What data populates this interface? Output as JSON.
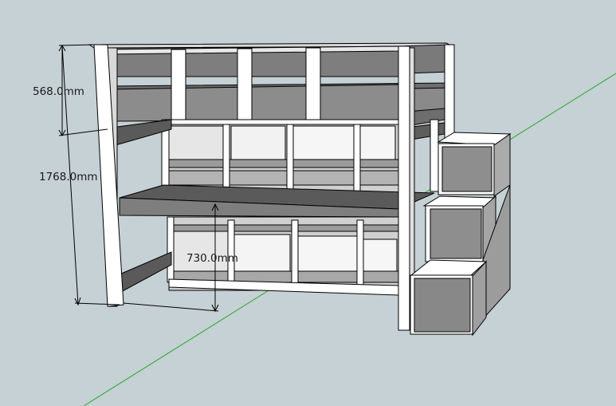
{
  "app": {
    "viewport_background": "#c5d1d5"
  },
  "scene": {
    "subject": "loft bed with desk, shelving and storage stairs",
    "axis_colors": {
      "green": "#2ea82e"
    },
    "material_colors": {
      "white_panel": "#ffffff",
      "light_gray_face": "#cfcfcf",
      "medium_gray_face": "#9a9a9a",
      "dark_gray_face": "#6e6e6e",
      "edge_line": "#000000"
    }
  },
  "dimensions": {
    "guardrail_height": "568.0mm",
    "total_height": "1768.0mm",
    "desk_height": "730.0mm"
  }
}
